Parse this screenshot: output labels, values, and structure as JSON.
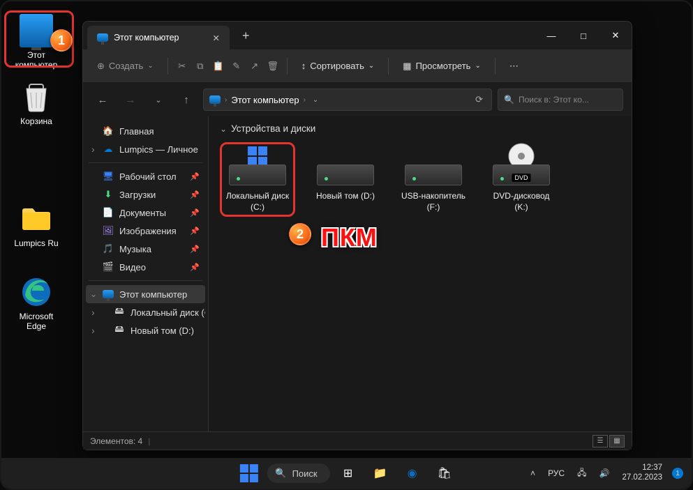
{
  "desktop": {
    "this_pc": "Этот компьютер",
    "recycle_bin": "Корзина",
    "folder": "Lumpics Ru",
    "edge": "Microsoft Edge"
  },
  "callouts": {
    "one": "1",
    "two": "2",
    "pkm": "ПКМ"
  },
  "explorer": {
    "tab_title": "Этот компьютер",
    "toolbar": {
      "create": "Создать",
      "sort": "Сортировать",
      "view": "Просмотреть"
    },
    "breadcrumb": "Этот компьютер",
    "search_placeholder": "Поиск в: Этот ко...",
    "sidebar": {
      "home": "Главная",
      "onedrive": "Lumpics — Личное",
      "desktop": "Рабочий стол",
      "downloads": "Загрузки",
      "documents": "Документы",
      "pictures": "Изображения",
      "music": "Музыка",
      "videos": "Видео",
      "this_pc": "Этот компьютер",
      "local_disk_c": "Локальный диск (C:)",
      "new_volume_d": "Новый том (D:)"
    },
    "content": {
      "group_title": "Устройства и диски",
      "drives": [
        {
          "name": "Локальный диск (C:)",
          "type": "os"
        },
        {
          "name": "Новый том (D:)",
          "type": "hdd"
        },
        {
          "name": "USB-накопитель (F:)",
          "type": "usb"
        },
        {
          "name": "DVD-дисковод (K:)",
          "type": "dvd",
          "badge": "DVD"
        }
      ]
    },
    "statusbar": "Элементов: 4"
  },
  "taskbar": {
    "search": "Поиск",
    "lang": "РУС",
    "time": "12:37",
    "date": "27.02.2023",
    "notif_count": "1"
  }
}
